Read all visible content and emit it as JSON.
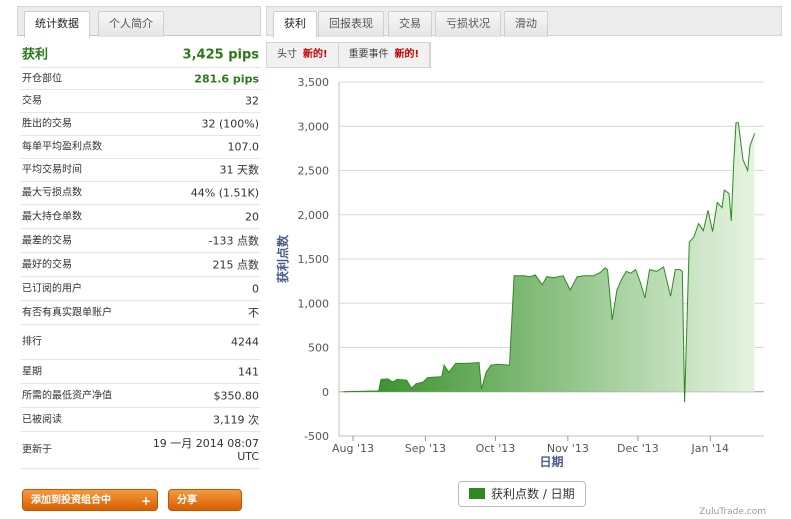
{
  "left_tabs": [
    "统计数据",
    "个人简介"
  ],
  "stats": {
    "profit_label": "获利",
    "profit_value": "3,425 pips",
    "rows": [
      {
        "label": "开仓部位",
        "value": "281.6 pips"
      },
      {
        "label": "交易",
        "value": "32"
      },
      {
        "label": "胜出的交易",
        "value": "32 (100%)"
      },
      {
        "label": "每单平均盈利点数",
        "value": "107.0"
      },
      {
        "label": "平均交易时间",
        "value": "31 天数"
      },
      {
        "label": "最大亏损点数",
        "value": "44% (1.51K)"
      },
      {
        "label": "最大持仓单数",
        "value": "20"
      },
      {
        "label": "最差的交易",
        "value": "-133 点数"
      },
      {
        "label": "最好的交易",
        "value": "215 点数"
      },
      {
        "label": "已订阅的用户",
        "value": "0"
      },
      {
        "label": "有否有真实跟单账户",
        "value": "不"
      },
      {
        "label": "排行",
        "value": "4244"
      },
      {
        "label": "星期",
        "value": "141"
      },
      {
        "label": "所需的最低资产净值",
        "value": "$350.80"
      },
      {
        "label": "已被阅读",
        "value": "3,119 次"
      },
      {
        "label": "更新于",
        "value": "19 一月 2014 08:07 UTC"
      }
    ]
  },
  "buttons": {
    "add_portfolio": "添加到投资组合中",
    "add_plus": "+",
    "share": "分享"
  },
  "right_tabs": [
    "获利",
    "回报表现",
    "交易",
    "亏损状况",
    "滑动"
  ],
  "sub_tabs": [
    {
      "label": "头寸",
      "badge": "新的!"
    },
    {
      "label": "重要事件",
      "badge": "新的!"
    }
  ],
  "watermark": "ZuluTrade.com",
  "colors": {
    "accent_green": "#2a7a19",
    "area_dark": "#2d8a1e",
    "area_light": "#e6f4e2",
    "button_orange": "#e67512",
    "badge_red": "#cc0000"
  },
  "chart_data": {
    "type": "area",
    "xlabel": "日期",
    "ylabel": "获利点数",
    "ylim": [
      -500,
      3500
    ],
    "yticks": [
      -500,
      0,
      500,
      1000,
      1500,
      2000,
      2500,
      3000,
      3500
    ],
    "ytick_labels": [
      "-500",
      "0",
      "500",
      "1,000",
      "1,500",
      "2,000",
      "2,500",
      "3,000",
      "3,500"
    ],
    "xlim": [
      "2013-07-26",
      "2014-01-24"
    ],
    "xticks": [
      "2013-08-01",
      "2013-09-01",
      "2013-10-01",
      "2013-11-01",
      "2013-12-01",
      "2014-01-01"
    ],
    "xtick_labels": [
      "Aug '13",
      "Sep '13",
      "Oct '13",
      "Nov '13",
      "Dec '13",
      "Jan '14"
    ],
    "grid": true,
    "legend": "bottom",
    "series": [
      {
        "name": "获利点数 / 日期",
        "points": [
          [
            "2013-07-28",
            0
          ],
          [
            "2013-08-12",
            10
          ],
          [
            "2013-08-13",
            140
          ],
          [
            "2013-08-16",
            145
          ],
          [
            "2013-08-18",
            110
          ],
          [
            "2013-08-20",
            140
          ],
          [
            "2013-08-24",
            130
          ],
          [
            "2013-08-26",
            40
          ],
          [
            "2013-08-28",
            90
          ],
          [
            "2013-08-31",
            110
          ],
          [
            "2013-09-02",
            160
          ],
          [
            "2013-09-05",
            165
          ],
          [
            "2013-09-08",
            170
          ],
          [
            "2013-09-09",
            300
          ],
          [
            "2013-09-11",
            220
          ],
          [
            "2013-09-14",
            320
          ],
          [
            "2013-09-19",
            320
          ],
          [
            "2013-09-24",
            330
          ],
          [
            "2013-09-25",
            30
          ],
          [
            "2013-09-27",
            220
          ],
          [
            "2013-09-29",
            300
          ],
          [
            "2013-10-02",
            310
          ],
          [
            "2013-10-07",
            300
          ],
          [
            "2013-10-09",
            1310
          ],
          [
            "2013-10-13",
            1310
          ],
          [
            "2013-10-16",
            1300
          ],
          [
            "2013-10-18",
            1320
          ],
          [
            "2013-10-21",
            1210
          ],
          [
            "2013-10-23",
            1300
          ],
          [
            "2013-10-26",
            1290
          ],
          [
            "2013-10-30",
            1310
          ],
          [
            "2013-11-02",
            1150
          ],
          [
            "2013-11-05",
            1300
          ],
          [
            "2013-11-08",
            1310
          ],
          [
            "2013-11-12",
            1310
          ],
          [
            "2013-11-15",
            1350
          ],
          [
            "2013-11-17",
            1400
          ],
          [
            "2013-11-18",
            1380
          ],
          [
            "2013-11-20",
            810
          ],
          [
            "2013-11-22",
            1150
          ],
          [
            "2013-11-24",
            1270
          ],
          [
            "2013-11-26",
            1360
          ],
          [
            "2013-11-28",
            1340
          ],
          [
            "2013-11-30",
            1380
          ],
          [
            "2013-12-02",
            1240
          ],
          [
            "2013-12-04",
            1060
          ],
          [
            "2013-12-06",
            1380
          ],
          [
            "2013-12-09",
            1360
          ],
          [
            "2013-12-12",
            1410
          ],
          [
            "2013-12-15",
            1080
          ],
          [
            "2013-12-17",
            1380
          ],
          [
            "2013-12-19",
            1380
          ],
          [
            "2013-12-20",
            1360
          ],
          [
            "2013-12-21",
            -120
          ],
          [
            "2013-12-23",
            1690
          ],
          [
            "2013-12-25",
            1750
          ],
          [
            "2013-12-27",
            1900
          ],
          [
            "2013-12-29",
            1820
          ],
          [
            "2013-12-31",
            2050
          ],
          [
            "2014-01-02",
            1810
          ],
          [
            "2014-01-04",
            2140
          ],
          [
            "2014-01-06",
            2080
          ],
          [
            "2014-01-07",
            2280
          ],
          [
            "2014-01-09",
            2240
          ],
          [
            "2014-01-10",
            1930
          ],
          [
            "2014-01-11",
            2560
          ],
          [
            "2014-01-12",
            3040
          ],
          [
            "2014-01-13",
            3040
          ],
          [
            "2014-01-15",
            2620
          ],
          [
            "2014-01-17",
            2500
          ],
          [
            "2014-01-18",
            2780
          ],
          [
            "2014-01-20",
            2920
          ]
        ]
      }
    ]
  }
}
